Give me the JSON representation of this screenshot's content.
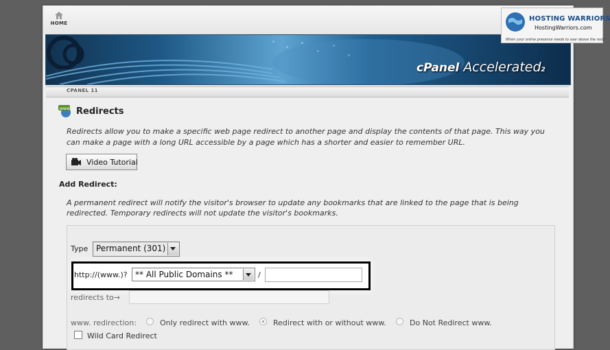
{
  "nav": {
    "home_label": "HOME"
  },
  "banner": {
    "brand_prefix": "cPanel",
    "brand_name": "Accelerated",
    "brand_version": "2"
  },
  "tab": {
    "label": "CPANEL 11"
  },
  "page": {
    "title": "Redirects",
    "description": "Redirects allow you to make a specific web page redirect to another page and display the contents of that page. This way you can make a page with a long URL accessible by a page which has a shorter and easier to remember URL.",
    "video_button_label": "Video Tutorial"
  },
  "add_redirect": {
    "heading": "Add Redirect:",
    "note": "A permanent redirect will notify the visitor's browser to update any bookmarks that are linked to the page that is being redirected. Temporary redirects will not update the visitor's bookmarks.",
    "type_label": "Type",
    "type_value": "Permanent (301)",
    "prefix": "http://(www.)?",
    "domain_value": "** All Public Domains **",
    "slash": "/",
    "path_value": "",
    "redirects_to_label": "redirects to→",
    "target_value": "",
    "www_label": "www. redirection:",
    "www_options": [
      "Only redirect with www.",
      "Redirect with or without www.",
      "Do Not Redirect www."
    ],
    "www_selected": 1,
    "wildcard_label": "Wild Card Redirect",
    "wildcard_checked": false
  },
  "watermark": {
    "name": "HOSTING WARRIORS",
    "url": "HostingWarriors.com",
    "tagline": "When your online presence needs to soar above the rest!"
  },
  "colors": {
    "highlight_border": "#000000",
    "page_bg": "#efefef",
    "backdrop": "#5f5f5f"
  }
}
